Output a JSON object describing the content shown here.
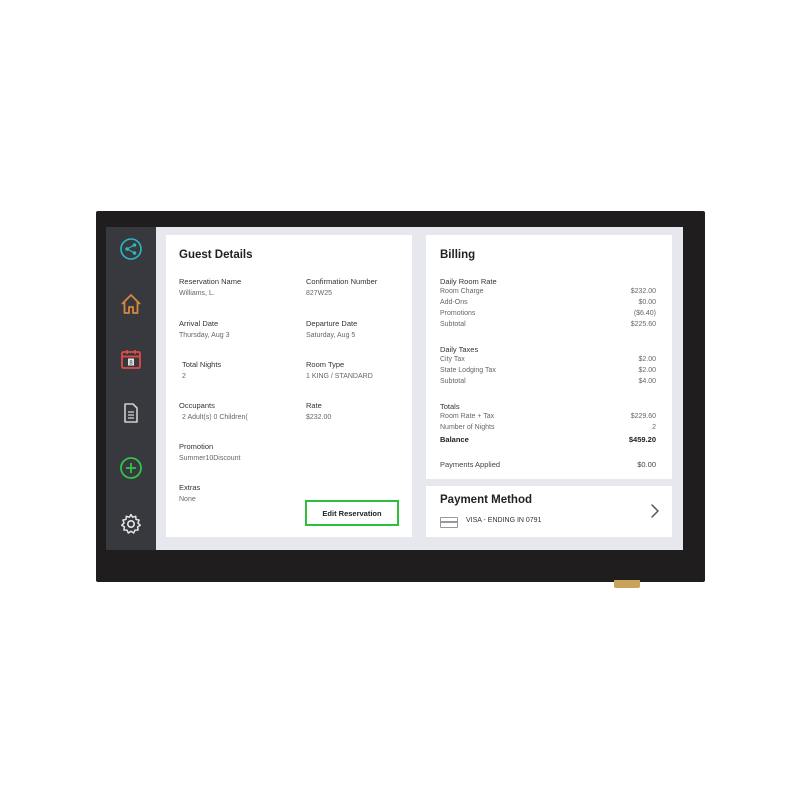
{
  "sidebar": {
    "items": [
      {
        "icon": "share-icon",
        "color": "#2bb8c2"
      },
      {
        "icon": "home-icon",
        "color": "#d6893b"
      },
      {
        "icon": "calendar-icon",
        "color": "#e24a4a",
        "day": "8"
      },
      {
        "icon": "document-icon",
        "color": "#cfcfcf"
      },
      {
        "icon": "add-icon",
        "color": "#33c24a"
      },
      {
        "icon": "gear-icon",
        "color": "#e6e6e6"
      }
    ]
  },
  "guest": {
    "title": "Guest Details",
    "reservation_name_label": "Reservation Name",
    "reservation_name": "Williams, L.",
    "confirmation_label": "Confirmation Number",
    "confirmation": "827W25",
    "arrival_label": "Arrival Date",
    "arrival": "Thursday, Aug 3",
    "departure_label": "Departure Date",
    "departure": "Saturday, Aug 5",
    "nights_label": "Total Nights",
    "nights": "2",
    "room_type_label": "Room Type",
    "room_type": "1 KING / STANDARD",
    "occupants_label": "Occupants",
    "occupants": "2 Adult(s)   0 Children(",
    "rate_label": "Rate",
    "rate": "$232.00",
    "promotion_label": "Promotion",
    "promotion": "Summer10Discount",
    "extras_label": "Extras",
    "extras": "None",
    "edit_label": "Edit Reservation"
  },
  "billing": {
    "title": "Billing",
    "daily_room_rate": {
      "heading": "Daily Room Rate",
      "rows": [
        {
          "label": "Room Charge",
          "amount": "$232.00"
        },
        {
          "label": "Add-Ons",
          "amount": "$0.00"
        },
        {
          "label": "Promotions",
          "amount": "($6.40)"
        },
        {
          "label": "Subtotal",
          "amount": "$225.60"
        }
      ]
    },
    "daily_taxes": {
      "heading": "Daily Taxes",
      "rows": [
        {
          "label": "City Tax",
          "amount": "$2.00"
        },
        {
          "label": "State Lodging Tax",
          "amount": "$2.00"
        },
        {
          "label": "Subtotal",
          "amount": "$4.00"
        }
      ]
    },
    "totals": {
      "heading": "Totals",
      "rows": [
        {
          "label": "Room Rate + Tax",
          "amount": "$229.60"
        },
        {
          "label": "Number of Nights",
          "amount": "2"
        }
      ],
      "balance_label": "Balance",
      "balance": "$459.20"
    },
    "payments_applied_label": "Payments Applied",
    "payments_applied": "$0.00"
  },
  "payment": {
    "title": "Payment Method",
    "card": "VISA  -  ENDING IN 0791"
  }
}
